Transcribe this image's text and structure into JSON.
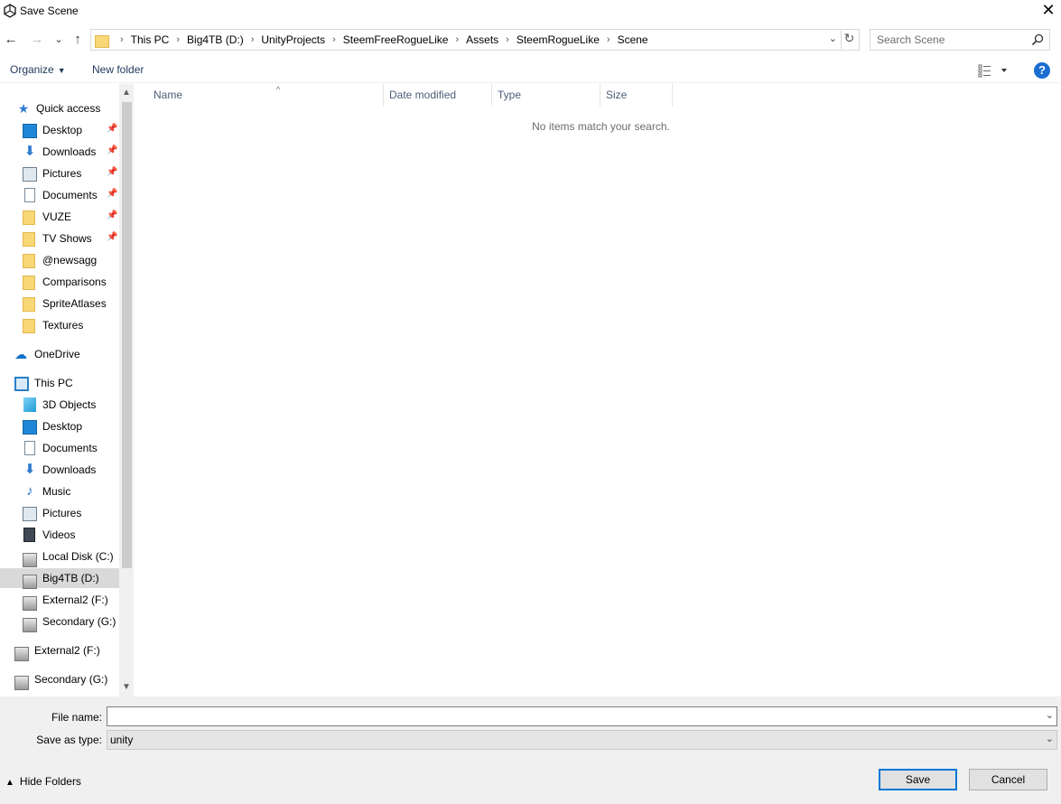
{
  "window": {
    "title": "Save Scene",
    "app_icon": "unity-icon",
    "close_glyph": "✕"
  },
  "navigation": {
    "back_glyph": "←",
    "forward_glyph": "→",
    "recent_glyph": "⌄",
    "up_glyph": "↑",
    "breadcrumbs": [
      "This PC",
      "Big4TB (D:)",
      "UnityProjects",
      "SteemFreeRogueLike",
      "Assets",
      "SteemRogueLike",
      "Scene"
    ],
    "crumb_separator": "›",
    "refresh_glyph": "↻"
  },
  "search": {
    "placeholder": "Search Scene"
  },
  "commands": {
    "organize": "Organize",
    "new_folder": "New folder",
    "help": "?"
  },
  "sidebar": {
    "quick_access": {
      "label": "Quick access",
      "items": [
        {
          "label": "Desktop",
          "icon": "desktop-icon",
          "pinned": true
        },
        {
          "label": "Downloads",
          "icon": "download-icon",
          "pinned": true
        },
        {
          "label": "Pictures",
          "icon": "pictures-icon",
          "pinned": true
        },
        {
          "label": "Documents",
          "icon": "documents-icon",
          "pinned": true
        },
        {
          "label": "VUZE",
          "icon": "folder-icon",
          "pinned": true
        },
        {
          "label": "TV Shows",
          "icon": "folder-icon",
          "pinned": true
        },
        {
          "label": "@newsagg",
          "icon": "folder-icon",
          "pinned": false
        },
        {
          "label": "Comparisons",
          "icon": "folder-icon",
          "pinned": false
        },
        {
          "label": "SpriteAtlases",
          "icon": "folder-icon",
          "pinned": false
        },
        {
          "label": "Textures",
          "icon": "folder-icon",
          "pinned": false
        }
      ]
    },
    "onedrive": "OneDrive",
    "this_pc": {
      "label": "This PC",
      "items": [
        {
          "label": "3D Objects",
          "icon": "3d-objects-icon"
        },
        {
          "label": "Desktop",
          "icon": "desktop-icon"
        },
        {
          "label": "Documents",
          "icon": "documents-icon"
        },
        {
          "label": "Downloads",
          "icon": "download-icon"
        },
        {
          "label": "Music",
          "icon": "music-icon"
        },
        {
          "label": "Pictures",
          "icon": "pictures-icon"
        },
        {
          "label": "Videos",
          "icon": "videos-icon"
        },
        {
          "label": "Local Disk (C:)",
          "icon": "local-disk-icon"
        },
        {
          "label": "Big4TB (D:)",
          "icon": "drive-icon",
          "selected": true
        },
        {
          "label": "External2 (F:)",
          "icon": "drive-icon"
        },
        {
          "label": "Secondary (G:)",
          "icon": "drive-icon"
        }
      ]
    },
    "external": "External2 (F:)",
    "secondary": "Secondary (G:)"
  },
  "file_list": {
    "columns": [
      "Name",
      "Date modified",
      "Type",
      "Size"
    ],
    "empty_message": "No items match your search."
  },
  "form": {
    "file_name_label": "File name:",
    "file_name_value": "",
    "save_type_label": "Save as type:",
    "save_type_value": "unity"
  },
  "footer": {
    "hide_folders": "Hide Folders",
    "save": "Save",
    "cancel": "Cancel"
  },
  "colors": {
    "accent": "#0078d7",
    "selected_bg": "#d9d9d9",
    "panel_bg": "#f0f0f0"
  }
}
